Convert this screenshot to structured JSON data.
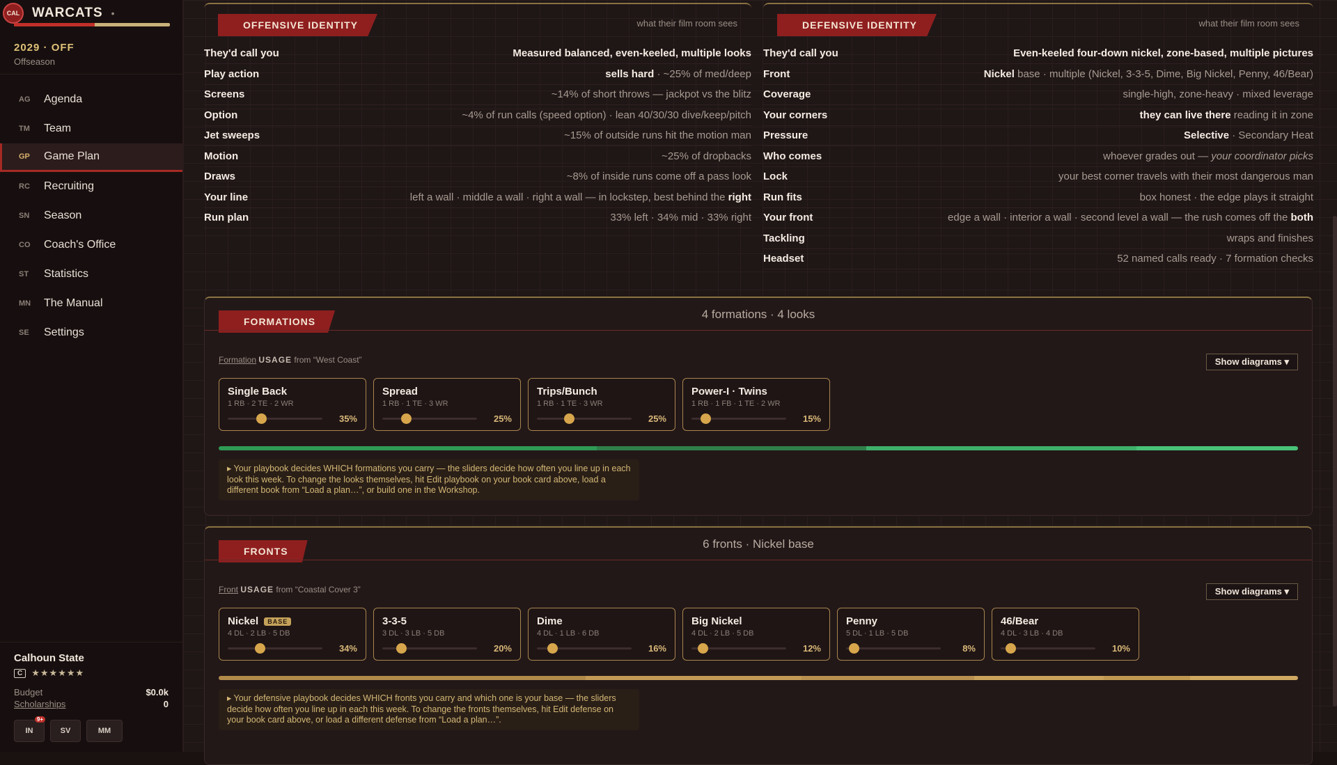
{
  "app": {
    "logo": "CAL",
    "name": "WARCATS",
    "menu_glyph": "•",
    "season": "2029 · OFF",
    "phase": "Offseason"
  },
  "nav": [
    {
      "abbr": "AG",
      "label": "Agenda"
    },
    {
      "abbr": "TM",
      "label": "Team"
    },
    {
      "abbr": "GP",
      "label": "Game Plan"
    },
    {
      "abbr": "RC",
      "label": "Recruiting"
    },
    {
      "abbr": "SN",
      "label": "Season"
    },
    {
      "abbr": "CO",
      "label": "Coach's Office"
    },
    {
      "abbr": "ST",
      "label": "Statistics"
    },
    {
      "abbr": "MN",
      "label": "The Manual"
    },
    {
      "abbr": "SE",
      "label": "Settings"
    }
  ],
  "active_nav": "Game Plan",
  "team": {
    "name": "Calhoun State",
    "grade": "C",
    "stars": "★★★★★★",
    "budget_label": "Budget",
    "budget_value": "$0.0k",
    "scholarships_label": "Scholarships",
    "scholarships_value": "0"
  },
  "quick_buttons": [
    {
      "label": "IN",
      "badge": "9+"
    },
    {
      "label": "SV"
    },
    {
      "label": "MM"
    }
  ],
  "offense": {
    "title": "OFFENSIVE IDENTITY",
    "note": "what their film room sees",
    "rows": [
      {
        "key": "They'd call you",
        "value": "Measured balanced, even-keeled, multiple looks",
        "bold_all": true
      },
      {
        "key": "Play action",
        "bold": "sells hard",
        "value": " · ~25% of med/deep"
      },
      {
        "key": "Screens",
        "value": "~14% of short throws — jackpot vs the blitz"
      },
      {
        "key": "Option",
        "value": "~4% of run calls (speed option) · lean 40/30/30 dive/keep/pitch"
      },
      {
        "key": "Jet sweeps",
        "value": "~15% of outside runs hit the motion man"
      },
      {
        "key": "Motion",
        "value": "~25% of dropbacks"
      },
      {
        "key": "Draws",
        "value": "~8% of inside runs come off a pass look"
      },
      {
        "key": "Your line",
        "value": "left a wall · middle a wall · right a wall — in lockstep, best behind the ",
        "tail_bold": "right"
      },
      {
        "key": "Run plan",
        "value": "33% left · 34% mid · 33% right"
      }
    ]
  },
  "defense": {
    "title": "DEFENSIVE IDENTITY",
    "note": "what their film room sees",
    "rows": [
      {
        "key": "They'd call you",
        "value": "Even-keeled four-down nickel, zone-based, multiple pictures",
        "bold_all": true
      },
      {
        "key": "Front",
        "bold": "Nickel",
        "value": " base · multiple (Nickel, 3-3-5, Dime, Big Nickel, Penny, 46/Bear)"
      },
      {
        "key": "Coverage",
        "value": "single-high, zone-heavy · mixed leverage"
      },
      {
        "key": "Your corners",
        "bold": "they can live there",
        "value": " reading it in zone"
      },
      {
        "key": "Pressure",
        "bold": "Selective",
        "value": " · Secondary Heat"
      },
      {
        "key": "Who comes",
        "value": "whoever grades out — ",
        "tail_italic": "your coordinator picks"
      },
      {
        "key": "Lock",
        "value": "your best corner travels with their most dangerous man"
      },
      {
        "key": "Run fits",
        "value": "box honest · the edge plays it straight"
      },
      {
        "key": "Your front",
        "value": "edge a wall · interior a wall · second level a wall — the rush comes off the ",
        "tail_bold": "both"
      },
      {
        "key": "Tackling",
        "value": "wraps and finishes"
      },
      {
        "key": "Headset",
        "value": "52 named calls ready · 7 formation checks"
      }
    ]
  },
  "formations": {
    "title": "FORMATIONS",
    "summary": "4 formations · 4 looks",
    "usage_prefix": "Formation",
    "usage_cap": "USAGE",
    "usage_source": "from “West Coast”",
    "diagram_button": "Show diagrams ▾",
    "items": [
      {
        "name": "Single Back",
        "sub": "1 RB · 2 TE · 2 WR",
        "pct_label": "35%",
        "pct": 0.35,
        "knob": 0.35
      },
      {
        "name": "Spread",
        "sub": "1 RB · 1 TE · 3 WR",
        "pct_label": "25%",
        "pct": 0.25,
        "knob": 0.25
      },
      {
        "name": "Trips/Bunch",
        "sub": "1 RB · 1 TE · 3 WR",
        "pct_label": "25%",
        "pct": 0.25,
        "knob": 0.34
      },
      {
        "name": "Power-I · Twins",
        "sub": "1 RB · 1 FB · 1 TE · 2 WR",
        "pct_label": "15%",
        "pct": 0.15,
        "knob": 0.15
      }
    ],
    "bar_colors": [
      "#2f9a55",
      "#2f7f4a",
      "#3fb06a",
      "#48c278"
    ],
    "note": "▸ Your playbook decides WHICH formations you carry — the sliders decide how often you line up in each look this week. To change the looks themselves, hit Edit playbook on your book card above, load a different book from “Load a plan…”, or build one in the Workshop."
  },
  "fronts": {
    "title": "FRONTS",
    "summary": "6 fronts · Nickel base",
    "usage_prefix": "Front",
    "usage_cap": "USAGE",
    "usage_source": "from “Coastal Cover 3”",
    "diagram_button": "Show diagrams ▾",
    "base_tag": "BASE",
    "items": [
      {
        "name": "Nickel",
        "sub": "4 DL · 2 LB · 5 DB",
        "pct_label": "34%",
        "pct": 0.34,
        "knob": 0.34,
        "base": true
      },
      {
        "name": "3-3-5",
        "sub": "3 DL · 3 LB · 5 DB",
        "pct_label": "20%",
        "pct": 0.2,
        "knob": 0.2
      },
      {
        "name": "Dime",
        "sub": "4 DL · 1 LB · 6 DB",
        "pct_label": "16%",
        "pct": 0.16,
        "knob": 0.16
      },
      {
        "name": "Big Nickel",
        "sub": "4 DL · 2 LB · 5 DB",
        "pct_label": "12%",
        "pct": 0.12,
        "knob": 0.12
      },
      {
        "name": "Penny",
        "sub": "5 DL · 1 LB · 5 DB",
        "pct_label": "8%",
        "pct": 0.08,
        "knob": 0.08
      },
      {
        "name": "46/Bear",
        "sub": "4 DL · 3 LB · 4 DB",
        "pct_label": "10%",
        "pct": 0.1,
        "knob": 0.1
      }
    ],
    "bar_colors": [
      "#b08a4a",
      "#c39a55",
      "#b89050",
      "#c9a25c",
      "#bf9852",
      "#cfa862"
    ],
    "note": "▸ Your defensive playbook decides WHICH fronts you carry and which one is your base — the sliders decide how often you line up in each this week. To change the fronts themselves, hit Edit defense on your book card above, or load a different defense from “Load a plan…”."
  }
}
